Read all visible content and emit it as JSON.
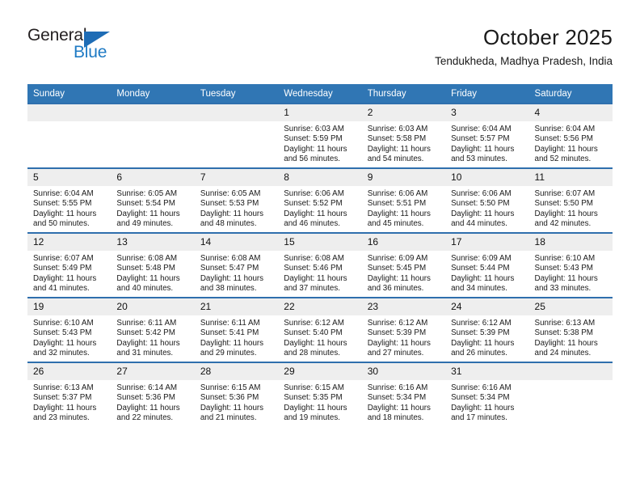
{
  "brand": {
    "line1": "General",
    "line2": "Blue",
    "triangle_color": "#1e6cb5",
    "line2_color": "#1e7ac4"
  },
  "header": {
    "title": "October 2025",
    "subtitle": "Tendukheda, Madhya Pradesh, India"
  },
  "theme": {
    "header_blue": "#3076b4",
    "rule_blue": "#2f6fad",
    "daynum_gray": "#eeeeee"
  },
  "weekday_headers": [
    "Sunday",
    "Monday",
    "Tuesday",
    "Wednesday",
    "Thursday",
    "Friday",
    "Saturday"
  ],
  "weeks": [
    [
      {
        "day": "",
        "sunrise": "",
        "sunset": "",
        "daylight1": "",
        "daylight2": ""
      },
      {
        "day": "",
        "sunrise": "",
        "sunset": "",
        "daylight1": "",
        "daylight2": ""
      },
      {
        "day": "",
        "sunrise": "",
        "sunset": "",
        "daylight1": "",
        "daylight2": ""
      },
      {
        "day": "1",
        "sunrise": "Sunrise: 6:03 AM",
        "sunset": "Sunset: 5:59 PM",
        "daylight1": "Daylight: 11 hours",
        "daylight2": "and 56 minutes."
      },
      {
        "day": "2",
        "sunrise": "Sunrise: 6:03 AM",
        "sunset": "Sunset: 5:58 PM",
        "daylight1": "Daylight: 11 hours",
        "daylight2": "and 54 minutes."
      },
      {
        "day": "3",
        "sunrise": "Sunrise: 6:04 AM",
        "sunset": "Sunset: 5:57 PM",
        "daylight1": "Daylight: 11 hours",
        "daylight2": "and 53 minutes."
      },
      {
        "day": "4",
        "sunrise": "Sunrise: 6:04 AM",
        "sunset": "Sunset: 5:56 PM",
        "daylight1": "Daylight: 11 hours",
        "daylight2": "and 52 minutes."
      }
    ],
    [
      {
        "day": "5",
        "sunrise": "Sunrise: 6:04 AM",
        "sunset": "Sunset: 5:55 PM",
        "daylight1": "Daylight: 11 hours",
        "daylight2": "and 50 minutes."
      },
      {
        "day": "6",
        "sunrise": "Sunrise: 6:05 AM",
        "sunset": "Sunset: 5:54 PM",
        "daylight1": "Daylight: 11 hours",
        "daylight2": "and 49 minutes."
      },
      {
        "day": "7",
        "sunrise": "Sunrise: 6:05 AM",
        "sunset": "Sunset: 5:53 PM",
        "daylight1": "Daylight: 11 hours",
        "daylight2": "and 48 minutes."
      },
      {
        "day": "8",
        "sunrise": "Sunrise: 6:06 AM",
        "sunset": "Sunset: 5:52 PM",
        "daylight1": "Daylight: 11 hours",
        "daylight2": "and 46 minutes."
      },
      {
        "day": "9",
        "sunrise": "Sunrise: 6:06 AM",
        "sunset": "Sunset: 5:51 PM",
        "daylight1": "Daylight: 11 hours",
        "daylight2": "and 45 minutes."
      },
      {
        "day": "10",
        "sunrise": "Sunrise: 6:06 AM",
        "sunset": "Sunset: 5:50 PM",
        "daylight1": "Daylight: 11 hours",
        "daylight2": "and 44 minutes."
      },
      {
        "day": "11",
        "sunrise": "Sunrise: 6:07 AM",
        "sunset": "Sunset: 5:50 PM",
        "daylight1": "Daylight: 11 hours",
        "daylight2": "and 42 minutes."
      }
    ],
    [
      {
        "day": "12",
        "sunrise": "Sunrise: 6:07 AM",
        "sunset": "Sunset: 5:49 PM",
        "daylight1": "Daylight: 11 hours",
        "daylight2": "and 41 minutes."
      },
      {
        "day": "13",
        "sunrise": "Sunrise: 6:08 AM",
        "sunset": "Sunset: 5:48 PM",
        "daylight1": "Daylight: 11 hours",
        "daylight2": "and 40 minutes."
      },
      {
        "day": "14",
        "sunrise": "Sunrise: 6:08 AM",
        "sunset": "Sunset: 5:47 PM",
        "daylight1": "Daylight: 11 hours",
        "daylight2": "and 38 minutes."
      },
      {
        "day": "15",
        "sunrise": "Sunrise: 6:08 AM",
        "sunset": "Sunset: 5:46 PM",
        "daylight1": "Daylight: 11 hours",
        "daylight2": "and 37 minutes."
      },
      {
        "day": "16",
        "sunrise": "Sunrise: 6:09 AM",
        "sunset": "Sunset: 5:45 PM",
        "daylight1": "Daylight: 11 hours",
        "daylight2": "and 36 minutes."
      },
      {
        "day": "17",
        "sunrise": "Sunrise: 6:09 AM",
        "sunset": "Sunset: 5:44 PM",
        "daylight1": "Daylight: 11 hours",
        "daylight2": "and 34 minutes."
      },
      {
        "day": "18",
        "sunrise": "Sunrise: 6:10 AM",
        "sunset": "Sunset: 5:43 PM",
        "daylight1": "Daylight: 11 hours",
        "daylight2": "and 33 minutes."
      }
    ],
    [
      {
        "day": "19",
        "sunrise": "Sunrise: 6:10 AM",
        "sunset": "Sunset: 5:43 PM",
        "daylight1": "Daylight: 11 hours",
        "daylight2": "and 32 minutes."
      },
      {
        "day": "20",
        "sunrise": "Sunrise: 6:11 AM",
        "sunset": "Sunset: 5:42 PM",
        "daylight1": "Daylight: 11 hours",
        "daylight2": "and 31 minutes."
      },
      {
        "day": "21",
        "sunrise": "Sunrise: 6:11 AM",
        "sunset": "Sunset: 5:41 PM",
        "daylight1": "Daylight: 11 hours",
        "daylight2": "and 29 minutes."
      },
      {
        "day": "22",
        "sunrise": "Sunrise: 6:12 AM",
        "sunset": "Sunset: 5:40 PM",
        "daylight1": "Daylight: 11 hours",
        "daylight2": "and 28 minutes."
      },
      {
        "day": "23",
        "sunrise": "Sunrise: 6:12 AM",
        "sunset": "Sunset: 5:39 PM",
        "daylight1": "Daylight: 11 hours",
        "daylight2": "and 27 minutes."
      },
      {
        "day": "24",
        "sunrise": "Sunrise: 6:12 AM",
        "sunset": "Sunset: 5:39 PM",
        "daylight1": "Daylight: 11 hours",
        "daylight2": "and 26 minutes."
      },
      {
        "day": "25",
        "sunrise": "Sunrise: 6:13 AM",
        "sunset": "Sunset: 5:38 PM",
        "daylight1": "Daylight: 11 hours",
        "daylight2": "and 24 minutes."
      }
    ],
    [
      {
        "day": "26",
        "sunrise": "Sunrise: 6:13 AM",
        "sunset": "Sunset: 5:37 PM",
        "daylight1": "Daylight: 11 hours",
        "daylight2": "and 23 minutes."
      },
      {
        "day": "27",
        "sunrise": "Sunrise: 6:14 AM",
        "sunset": "Sunset: 5:36 PM",
        "daylight1": "Daylight: 11 hours",
        "daylight2": "and 22 minutes."
      },
      {
        "day": "28",
        "sunrise": "Sunrise: 6:15 AM",
        "sunset": "Sunset: 5:36 PM",
        "daylight1": "Daylight: 11 hours",
        "daylight2": "and 21 minutes."
      },
      {
        "day": "29",
        "sunrise": "Sunrise: 6:15 AM",
        "sunset": "Sunset: 5:35 PM",
        "daylight1": "Daylight: 11 hours",
        "daylight2": "and 19 minutes."
      },
      {
        "day": "30",
        "sunrise": "Sunrise: 6:16 AM",
        "sunset": "Sunset: 5:34 PM",
        "daylight1": "Daylight: 11 hours",
        "daylight2": "and 18 minutes."
      },
      {
        "day": "31",
        "sunrise": "Sunrise: 6:16 AM",
        "sunset": "Sunset: 5:34 PM",
        "daylight1": "Daylight: 11 hours",
        "daylight2": "and 17 minutes."
      },
      {
        "day": "",
        "sunrise": "",
        "sunset": "",
        "daylight1": "",
        "daylight2": ""
      }
    ]
  ]
}
